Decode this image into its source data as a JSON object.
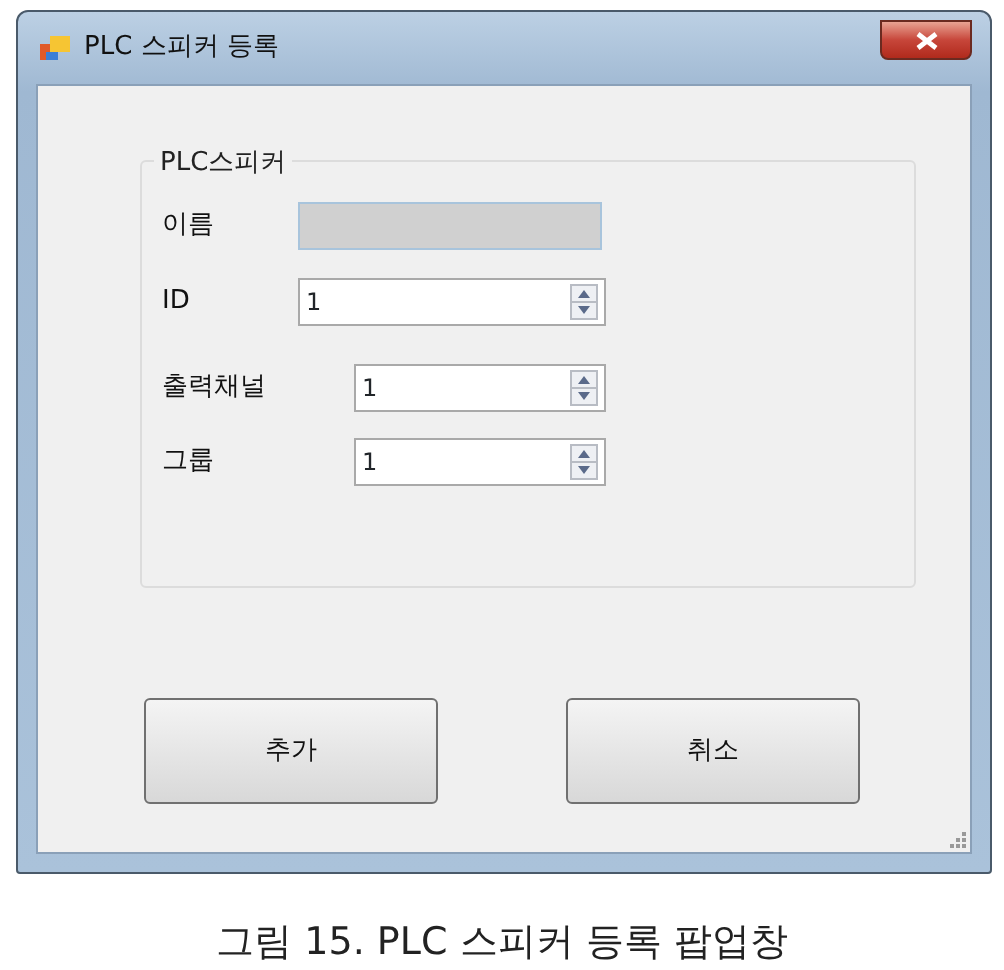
{
  "window": {
    "title": "PLC 스피커 등록"
  },
  "group": {
    "legend": "PLC스피커",
    "fields": [
      {
        "label": "이름",
        "kind": "text",
        "disabled": true
      },
      {
        "label": "ID",
        "kind": "spin",
        "value": "1",
        "disabled": false
      },
      {
        "label": "출력채널",
        "kind": "spin",
        "value": "1",
        "disabled": false
      },
      {
        "label": "그룹",
        "kind": "spin",
        "value": "1",
        "disabled": false
      }
    ]
  },
  "buttons": [
    "추가",
    "취소"
  ],
  "caption": "그림 15. PLC 스피커 등록 팝업창"
}
